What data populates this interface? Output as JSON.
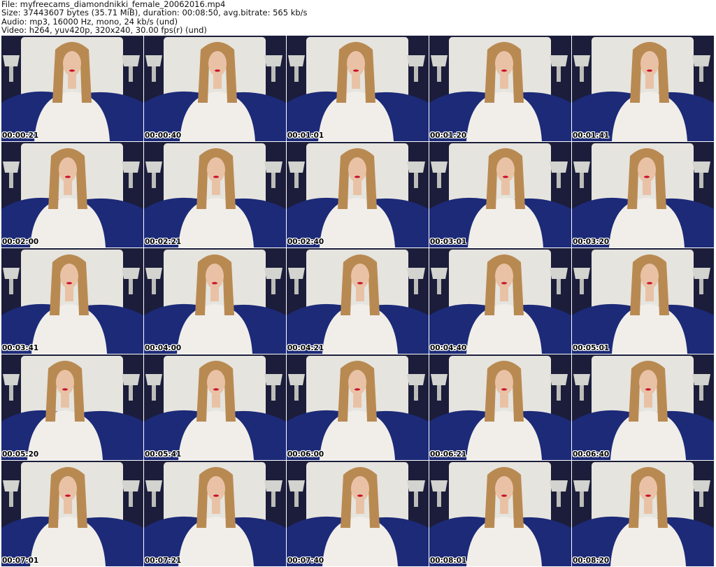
{
  "header": {
    "file": "File: myfreecams_diamondnikki_female_20062016.mp4",
    "size": "Size: 37443607 bytes (35.71 MiB), duration: 00:08:50, avg.bitrate: 565 kb/s",
    "audio": "Audio: mp3, 16000 Hz, mono, 24 kb/s (und)",
    "video": "Video: h264, yuv420p, 320x240, 30.00 fps(r) (und)"
  },
  "thumbnails": [
    {
      "timestamp": "00:00:21"
    },
    {
      "timestamp": "00:00:40"
    },
    {
      "timestamp": "00:01:01"
    },
    {
      "timestamp": "00:01:20"
    },
    {
      "timestamp": "00:01:41"
    },
    {
      "timestamp": "00:02:00"
    },
    {
      "timestamp": "00:02:21"
    },
    {
      "timestamp": "00:02:40"
    },
    {
      "timestamp": "00:03:01"
    },
    {
      "timestamp": "00:03:20"
    },
    {
      "timestamp": "00:03:41"
    },
    {
      "timestamp": "00:04:00"
    },
    {
      "timestamp": "00:04:21"
    },
    {
      "timestamp": "00:04:40"
    },
    {
      "timestamp": "00:05:01"
    },
    {
      "timestamp": "00:05:20"
    },
    {
      "timestamp": "00:05:41"
    },
    {
      "timestamp": "00:06:00"
    },
    {
      "timestamp": "00:06:21"
    },
    {
      "timestamp": "00:06:40"
    },
    {
      "timestamp": "00:07:01"
    },
    {
      "timestamp": "00:07:21"
    },
    {
      "timestamp": "00:07:40"
    },
    {
      "timestamp": "00:08:01"
    },
    {
      "timestamp": "00:08:20"
    }
  ],
  "colors": {
    "wall": "#1b1d3a",
    "headboard": "#e6e4de",
    "bedding": "#1c2a78",
    "lamp": "#d3d3cf",
    "hair": "#b88a52",
    "skin": "#e9c2a6",
    "top": "#f1eeea"
  }
}
